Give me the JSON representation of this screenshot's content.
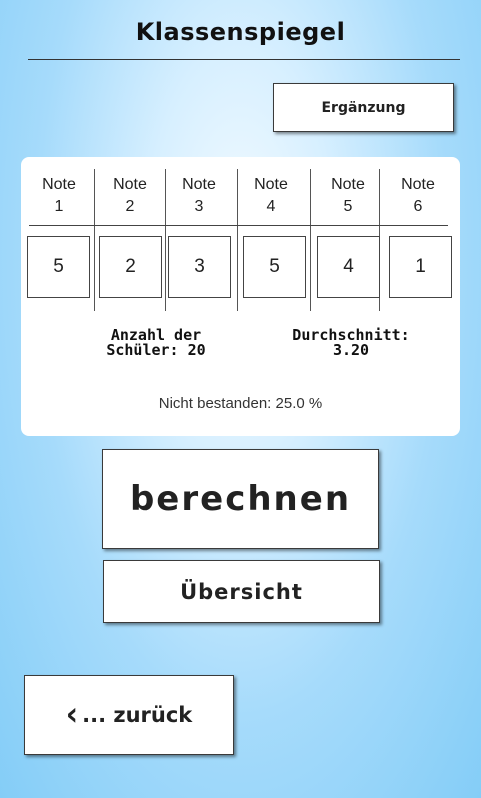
{
  "header": {
    "title": "Klassenspiegel"
  },
  "buttons": {
    "ergaenzung": "Ergänzung",
    "berechnen": "berechnen",
    "uebersicht": "Übersicht",
    "zurueck": "... zurück"
  },
  "grades": {
    "columns": [
      {
        "label_top": "Note",
        "label_bottom": "1",
        "value": "5"
      },
      {
        "label_top": "Note",
        "label_bottom": "2",
        "value": "2"
      },
      {
        "label_top": "Note",
        "label_bottom": "3",
        "value": "3"
      },
      {
        "label_top": "Note",
        "label_bottom": "4",
        "value": "5"
      },
      {
        "label_top": "Note",
        "label_bottom": "5",
        "value": "4"
      },
      {
        "label_top": "Note",
        "label_bottom": "6",
        "value": "1"
      }
    ]
  },
  "stats": {
    "count_line1": "Anzahl der",
    "count_line2": "Schüler: 20",
    "avg_line1": "Durchschnitt:",
    "avg_line2": "3.20",
    "failed": "Nicht bestanden: 25.0 %"
  },
  "icons": {
    "back": "chevron-left-icon"
  }
}
